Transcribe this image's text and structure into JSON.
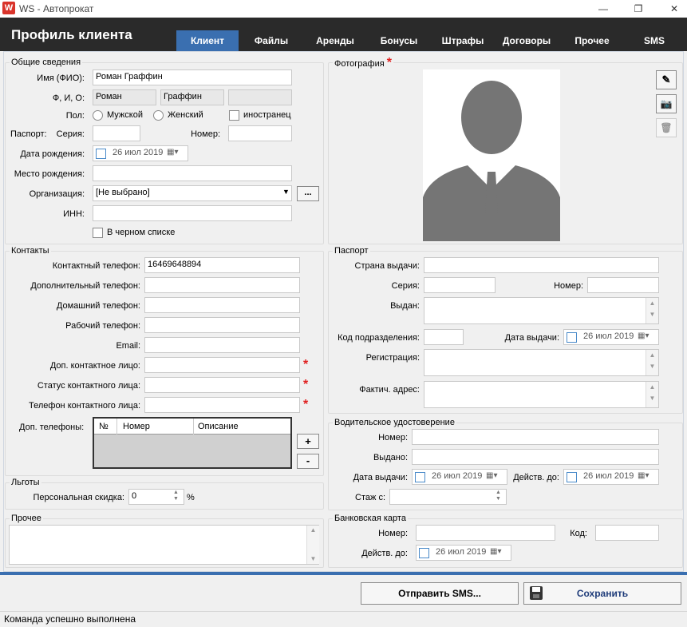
{
  "window": {
    "title": "WS - Автопрокат",
    "app_icon": "W"
  },
  "header": {
    "title": "Профиль клиента"
  },
  "tabs": [
    "Клиент",
    "Файлы",
    "Аренды",
    "Бонусы",
    "Штрафы",
    "Договоры",
    "Прочее",
    "SMS"
  ],
  "general": {
    "title": "Общие сведения",
    "name_label": "Имя (ФИО):",
    "name_value": "Роман Граффин",
    "fio_label": "Ф, И, О:",
    "first": "Роман",
    "last": "Граффин",
    "middle": "",
    "gender_label": "Пол:",
    "male": "Мужской",
    "female": "Женский",
    "foreigner": "иностранец",
    "passport_label": "Паспорт:",
    "series_label": "Серия:",
    "number_label": "Номер:",
    "dob_label": "Дата рождения:",
    "dob": "26 июл 2019",
    "pob_label": "Место рождения:",
    "org_label": "Организация:",
    "org_value": "[Не выбрано]",
    "org_more": "...",
    "inn_label": "ИНН:",
    "blacklist": "В черном списке"
  },
  "contacts": {
    "title": "Контакты",
    "phone_label": "Контактный телефон:",
    "phone": "16469648894",
    "extra_phone_label": "Дополнительный телефон:",
    "home_phone_label": "Домашний телефон:",
    "work_phone_label": "Рабочий телефон:",
    "email_label": "Email:",
    "contact_person_label": "Доп. контактное лицо:",
    "contact_status_label": "Статус контактного лица:",
    "contact_phone_label": "Телефон контактного лица:",
    "extra_phones_label": "Доп. телефоны:",
    "table_headers": [
      "№",
      "Номер",
      "Описание"
    ],
    "add": "+",
    "remove": "-"
  },
  "benefits": {
    "title": "Льготы",
    "discount_label": "Персональная скидка:",
    "discount": "0",
    "percent": "%"
  },
  "other": {
    "title": "Прочее"
  },
  "photo": {
    "title": "Фотография"
  },
  "passport": {
    "title": "Паспорт",
    "country_label": "Страна выдачи:",
    "series_label": "Серия:",
    "number_label": "Номер:",
    "issued_label": "Выдан:",
    "code_label": "Код подразделения:",
    "issue_date_label": "Дата выдачи:",
    "issue_date": "26 июл 2019",
    "registration_label": "Регистрация:",
    "address_label": "Фактич. адрес:"
  },
  "license": {
    "title": "Водительское удостоверение",
    "number_label": "Номер:",
    "issued_label": "Выдано:",
    "issue_date_label": "Дата выдачи:",
    "issue_date": "26 июл 2019",
    "valid_label": "Действ. до:",
    "valid_date": "26 июл 2019",
    "experience_label": "Стаж с:"
  },
  "bank": {
    "title": "Банковская карта",
    "number_label": "Номер:",
    "code_label": "Код:",
    "valid_label": "Действ. до:",
    "valid_date": "26 июл 2019"
  },
  "footer": {
    "send_sms": "Отправить SMS...",
    "save": "Сохранить"
  },
  "status": {
    "text": "Команда успешно выполнена"
  },
  "colors": {
    "header_bg": "#2a2a2a",
    "tab_active": "#3a6fb0",
    "required": "#e02020",
    "save_text": "#1f3c7a"
  }
}
